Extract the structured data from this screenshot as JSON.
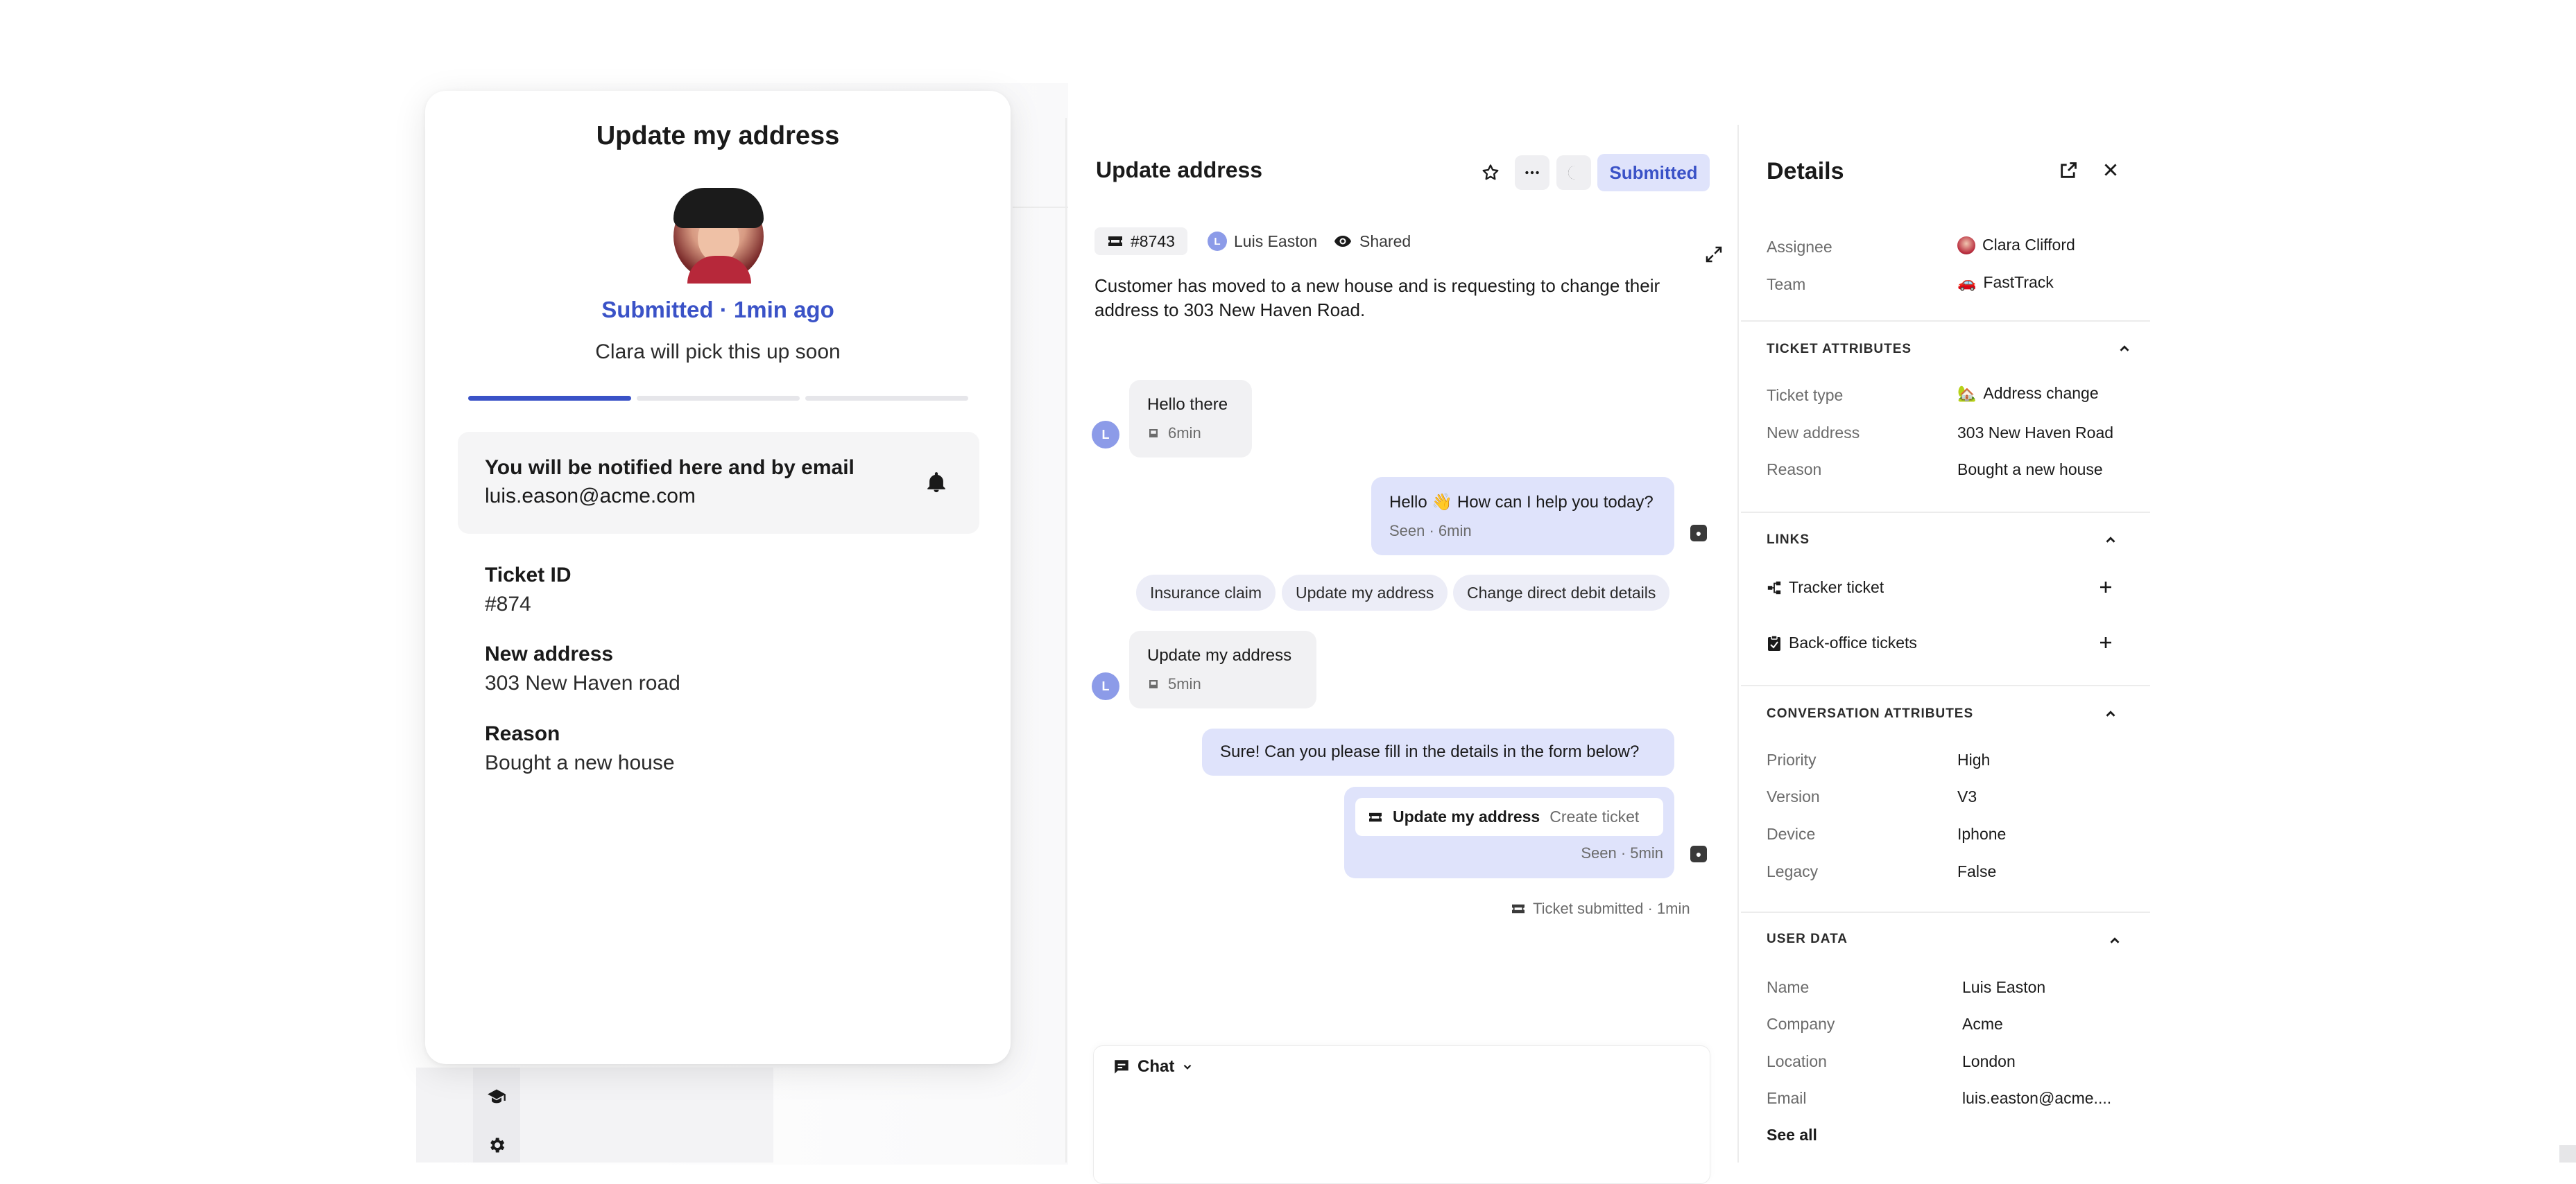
{
  "card": {
    "title": "Update my address",
    "status": "Submitted · 1min ago",
    "subtitle": "Clara will pick this up soon",
    "progress_completed_steps": 1,
    "progress_total_steps": 3,
    "notify_title": "You will be notified here and by email",
    "notify_email": "luis.eason@acme.com",
    "fields": [
      {
        "label": "Ticket ID",
        "value": "#874"
      },
      {
        "label": "New address",
        "value": "303 New Haven road"
      },
      {
        "label": "Reason",
        "value": "Bought a new house"
      }
    ]
  },
  "conversation": {
    "title": "Update address",
    "status_label": "Submitted",
    "ticket_number": "#8743",
    "customer_initial": "L",
    "customer_name": "Luis Easton",
    "visibility": "Shared",
    "description": "Customer has moved to a new house and is requesting to change their address to 303 New Haven Road.",
    "messages": [
      {
        "text": "Hello there",
        "time": "6min"
      },
      {
        "text": "Hello 👋 How can I help you today?",
        "time": "Seen · 6min"
      },
      {
        "text": "Update my address",
        "time": "5min"
      },
      {
        "text": "Sure! Can you please fill in the details in the form below?"
      }
    ],
    "quick_replies": [
      "Insurance claim",
      "Update my address",
      "Change direct debit details"
    ],
    "ticket_card": {
      "title": "Update my address",
      "action": "Create ticket",
      "time": "Seen · 5min"
    },
    "system_event": "Ticket submitted · 1min",
    "composer_mode": "Chat"
  },
  "details": {
    "title": "Details",
    "assignee_label": "Assignee",
    "assignee": "Clara Clifford",
    "team_label": "Team",
    "team": "FastTrack",
    "sections": {
      "ticket_attributes": "TICKET ATTRIBUTES",
      "links": "LINKS",
      "conversation_attributes": "CONVERSATION ATTRIBUTES",
      "user_data": "USER DATA"
    },
    "ticket_attributes": [
      {
        "key": "Ticket type",
        "value": "Address change"
      },
      {
        "key": "New address",
        "value": "303 New Haven Road"
      },
      {
        "key": "Reason",
        "value": "Bought a new house"
      }
    ],
    "links": [
      "Tracker ticket",
      "Back-office tickets"
    ],
    "conversation_attributes": [
      {
        "key": "Priority",
        "value": "High"
      },
      {
        "key": "Version",
        "value": "V3"
      },
      {
        "key": "Device",
        "value": "Iphone"
      },
      {
        "key": "Legacy",
        "value": "False"
      }
    ],
    "user_data": [
      {
        "key": "Name",
        "value": "Luis Easton"
      },
      {
        "key": "Company",
        "value": "Acme"
      },
      {
        "key": "Location",
        "value": "London"
      },
      {
        "key": "Email",
        "value": "luis.easton@acme...."
      }
    ],
    "see_all": "See all"
  },
  "colors": {
    "accent": "#3a52c7",
    "accent_soft": "#dfe3fb",
    "bubble_in": "#f1f1f3",
    "avatar_bg": "#8c9be8"
  },
  "icons": [
    "graduation-cap-icon",
    "gear-icon",
    "bell-icon",
    "star-icon",
    "more-icon",
    "snooze-icon",
    "ticket-icon",
    "eye-icon",
    "expand-icon",
    "external-link-icon",
    "close-icon",
    "chevron-up-icon",
    "plus-icon",
    "tracker-icon",
    "clipboard-icon",
    "chat-icon",
    "chevron-down-icon",
    "bot-icon",
    "inbox-icon"
  ]
}
